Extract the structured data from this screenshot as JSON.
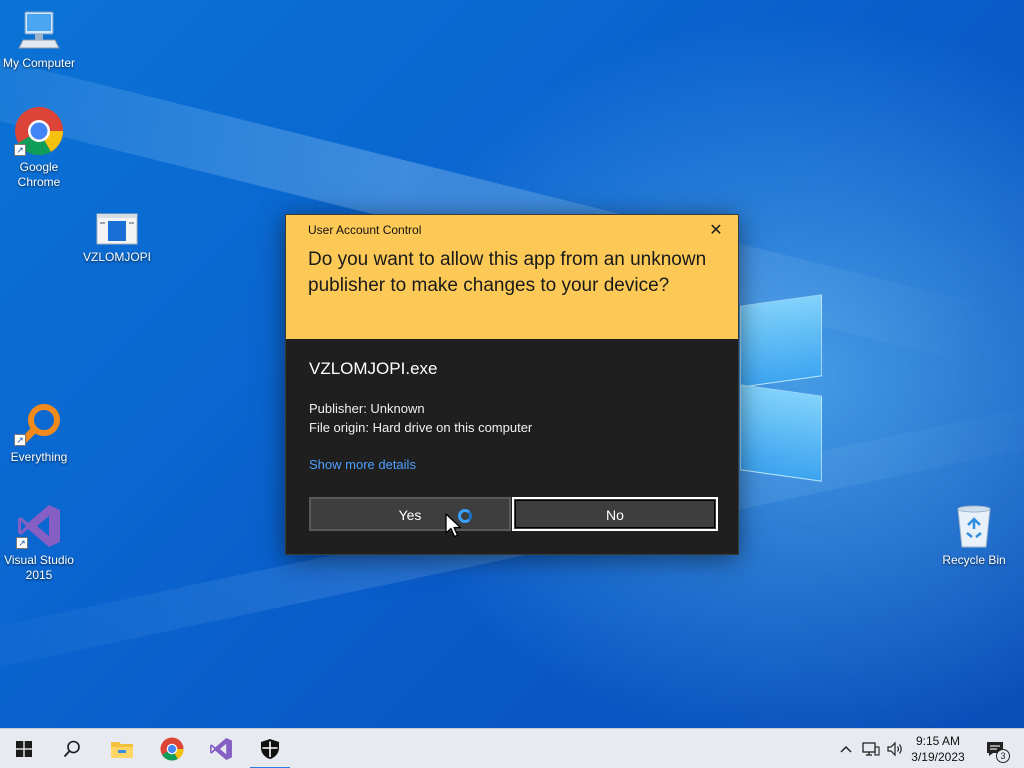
{
  "desktop": {
    "icons": [
      {
        "label": "My Computer",
        "icon": "computer-icon"
      },
      {
        "label": "Google Chrome",
        "icon": "chrome-icon"
      },
      {
        "label": "VZLOMJOPI",
        "icon": "app-icon"
      },
      {
        "label": "Everything",
        "icon": "everything-search-icon"
      },
      {
        "label": "Visual Studio 2015",
        "icon": "visual-studio-icon"
      },
      {
        "label": "Recycle Bin",
        "icon": "recycle-bin-icon"
      }
    ]
  },
  "uac": {
    "caption": "User Account Control",
    "question": "Do you want to allow this app from an unknown publisher to make changes to your device?",
    "app_name": "VZLOMJOPI.exe",
    "publisher": "Publisher: Unknown",
    "file_origin": "File origin: Hard drive on this computer",
    "details_link": "Show more details",
    "yes_label": "Yes",
    "no_label": "No",
    "header_color": "#fcc957",
    "body_color": "#1f1f1f",
    "link_color": "#4ea0ff"
  },
  "taskbar": {
    "pinned": [
      "start-icon",
      "search-icon",
      "file-explorer-icon",
      "chrome-icon",
      "visual-studio-icon",
      "security-shield-icon"
    ],
    "time": "9:15 AM",
    "date": "3/19/2023",
    "notification_count": "3"
  }
}
